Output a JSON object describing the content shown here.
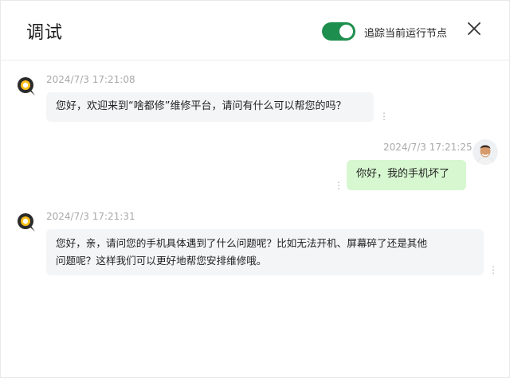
{
  "header": {
    "title": "调试",
    "toggle_on": true,
    "toggle_label": "追踪当前运行节点",
    "accent_color": "#1e8e4e"
  },
  "messages": [
    {
      "role": "bot",
      "timestamp": "2024/7/3 17:21:08",
      "text": "您好，欢迎来到“啥都修”维修平台，请问有什么可以帮您的吗？"
    },
    {
      "role": "user",
      "timestamp": "2024/7/3 17:21:25",
      "text": "你好，我的手机坏了"
    },
    {
      "role": "bot",
      "timestamp": "2024/7/3 17:21:31",
      "text_line1": "您好，亲，请问您的手机具体遇到了什么问题呢？比如无法开机、屏幕碎了还是其他",
      "text_line2": "问题呢？这样我们可以更好地帮您安排维修哦。"
    }
  ],
  "icons": {
    "close": "close-icon",
    "more": "more-vertical-icon",
    "bot_avatar": "bot-avatar-icon",
    "user_avatar": "user-avatar"
  },
  "colors": {
    "bot_bubble": "#f4f5f7",
    "user_bubble": "#d6f7cf",
    "timestamp": "#a9a9a9"
  }
}
